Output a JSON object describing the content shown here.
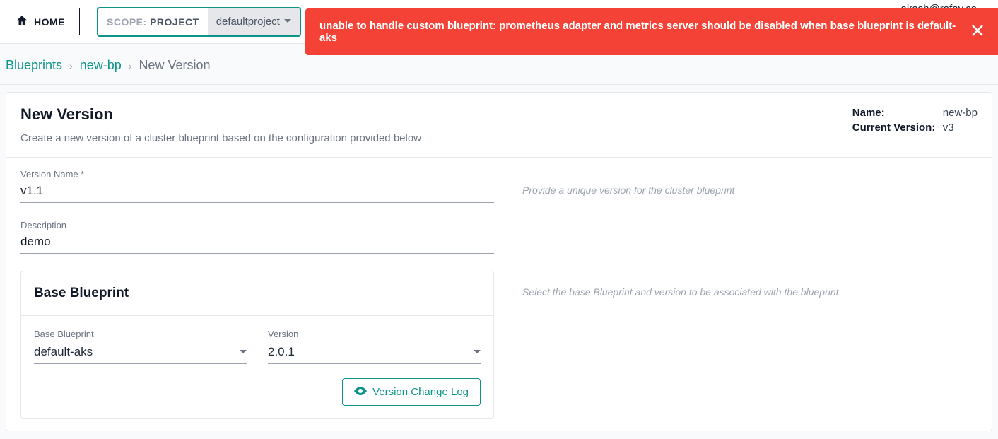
{
  "topbar": {
    "home": "HOME",
    "scope_prefix": "SCOPE:",
    "scope_kind": "PROJECT",
    "scope_value": "defaultproject",
    "user_email": "akash@rafay.co"
  },
  "error": {
    "message": "unable to handle custom blueprint: prometheus adapter and metrics server should be disabled when base blueprint is default-aks"
  },
  "breadcrumb": {
    "root": "Blueprints",
    "level1": "new-bp",
    "current": "New Version"
  },
  "card": {
    "title": "New Version",
    "subtitle": "Create a new version of a cluster blueprint based on the configuration provided below",
    "meta": {
      "name_label": "Name:",
      "name_value": "new-bp",
      "version_label": "Current Version:",
      "version_value": "v3"
    }
  },
  "form": {
    "version_name": {
      "label": "Version Name *",
      "value": "v1.1",
      "hint": "Provide a unique version for the cluster blueprint"
    },
    "description": {
      "label": "Description",
      "value": "demo"
    },
    "base": {
      "card_title": "Base Blueprint",
      "blueprint": {
        "label": "Base Blueprint",
        "value": "default-aks"
      },
      "version": {
        "label": "Version",
        "value": "2.0.1"
      },
      "hint": "Select the base Blueprint and version to be associated with the blueprint",
      "changelog_label": "Version Change Log"
    }
  }
}
